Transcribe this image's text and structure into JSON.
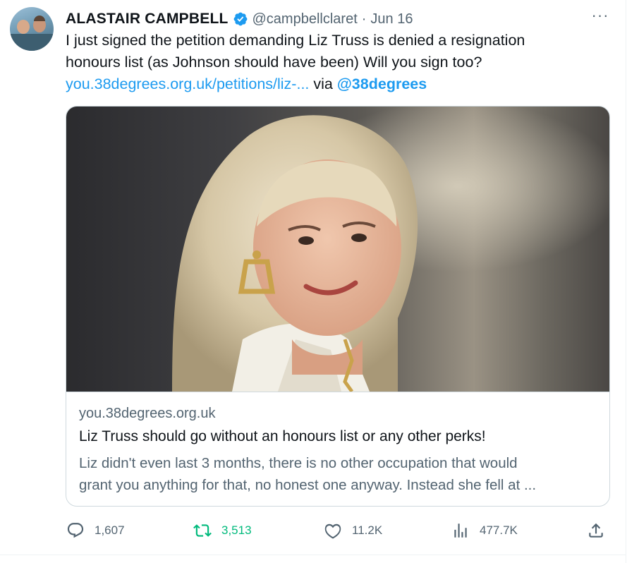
{
  "tweet": {
    "author_name": "ALASTAIR CAMPBELL",
    "author_handle": "@campbellclaret",
    "separator": "·",
    "date": "Jun 16",
    "more_label": "···",
    "text_line1": "I just signed the petition demanding Liz Truss is denied a resignation",
    "text_line2": "honours list (as Johnson should have been) Will you sign too?",
    "link_text": "you.38degrees.org.uk/petitions/liz-...",
    "via_text": "via",
    "mention": "@38degrees"
  },
  "card": {
    "domain": "you.38degrees.org.uk",
    "title": "Liz Truss should go without an honours list or any other perks!",
    "description_line1": "Liz didn't even last 3 months, there is no other occupation that would",
    "description_line2": "grant you anything for that, no honest one anyway. Instead she fell at ..."
  },
  "actions": {
    "replies": "1,607",
    "retweets": "3,513",
    "likes": "11.2K",
    "views": "477.7K"
  },
  "colors": {
    "accent": "#1d9bf0",
    "secondary_text": "#536471",
    "retweet_green": "#00ba7c",
    "border": "#cfd9de"
  },
  "icons": {
    "verified": "verified-badge-icon",
    "more": "more-dots-icon",
    "reply": "reply-icon",
    "retweet": "retweet-icon",
    "like": "heart-icon",
    "views": "views-chart-icon",
    "share": "share-icon"
  }
}
